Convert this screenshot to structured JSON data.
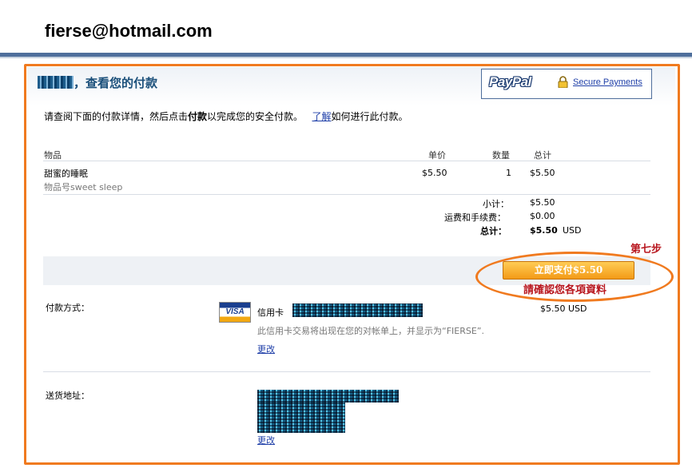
{
  "account": {
    "email": "fierse@hotmail.com"
  },
  "header": {
    "title": "，查看您的付款",
    "paypal_logo": "PayPal",
    "secure_label": "Secure Payments"
  },
  "intro": {
    "part1": "请查阅下面的付款详情，然后点击",
    "bold": "付款",
    "part2": "以完成您的安全付款。",
    "link": "了解",
    "part3": "如何进行此付款。"
  },
  "table": {
    "headers": {
      "item": "物品",
      "price": "单价",
      "qty": "数量",
      "total": "总计"
    },
    "item": {
      "name": "甜蜜的睡眠",
      "sku": "物品号sweet sleep",
      "price": "$5.50",
      "qty": "1",
      "total": "$5.50"
    }
  },
  "summary": {
    "subtotal_label": "小计：",
    "subtotal": "$5.50",
    "shipping_label": "运费和手续费：",
    "shipping": "$0.00",
    "total_label": "总计：",
    "total": "$5.50",
    "currency": "USD"
  },
  "pay_button": "立即支付$5.50",
  "annotations": {
    "step": "第七步",
    "confirm": "請確認您各項資料"
  },
  "payment": {
    "label": "付款方式：",
    "card_type": "信用卡",
    "card_logo": "VISA",
    "amount": "$5.50 USD",
    "note": "此信用卡交易将出现在您的对帐单上，并显示为“FIERSE”.",
    "change": "更改"
  },
  "shipping_addr": {
    "label": "送货地址：",
    "change": "更改"
  },
  "colors": {
    "accent_orange": "#f07a1f",
    "link_blue": "#1f3fa8",
    "annotation_red": "#b8161e"
  }
}
